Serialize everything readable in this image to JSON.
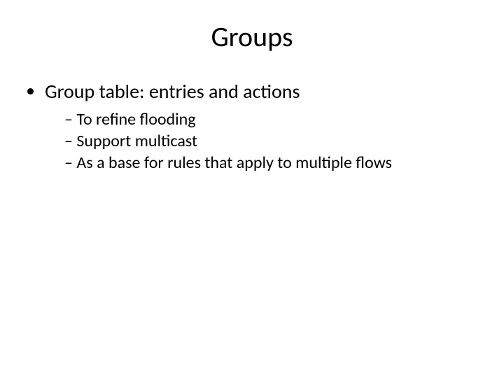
{
  "title": "Groups",
  "bullets": [
    {
      "text": "Group table: entries and actions",
      "sub": [
        "To refine flooding",
        "Support multicast",
        "As a base for rules that apply to multiple flows"
      ]
    }
  ]
}
